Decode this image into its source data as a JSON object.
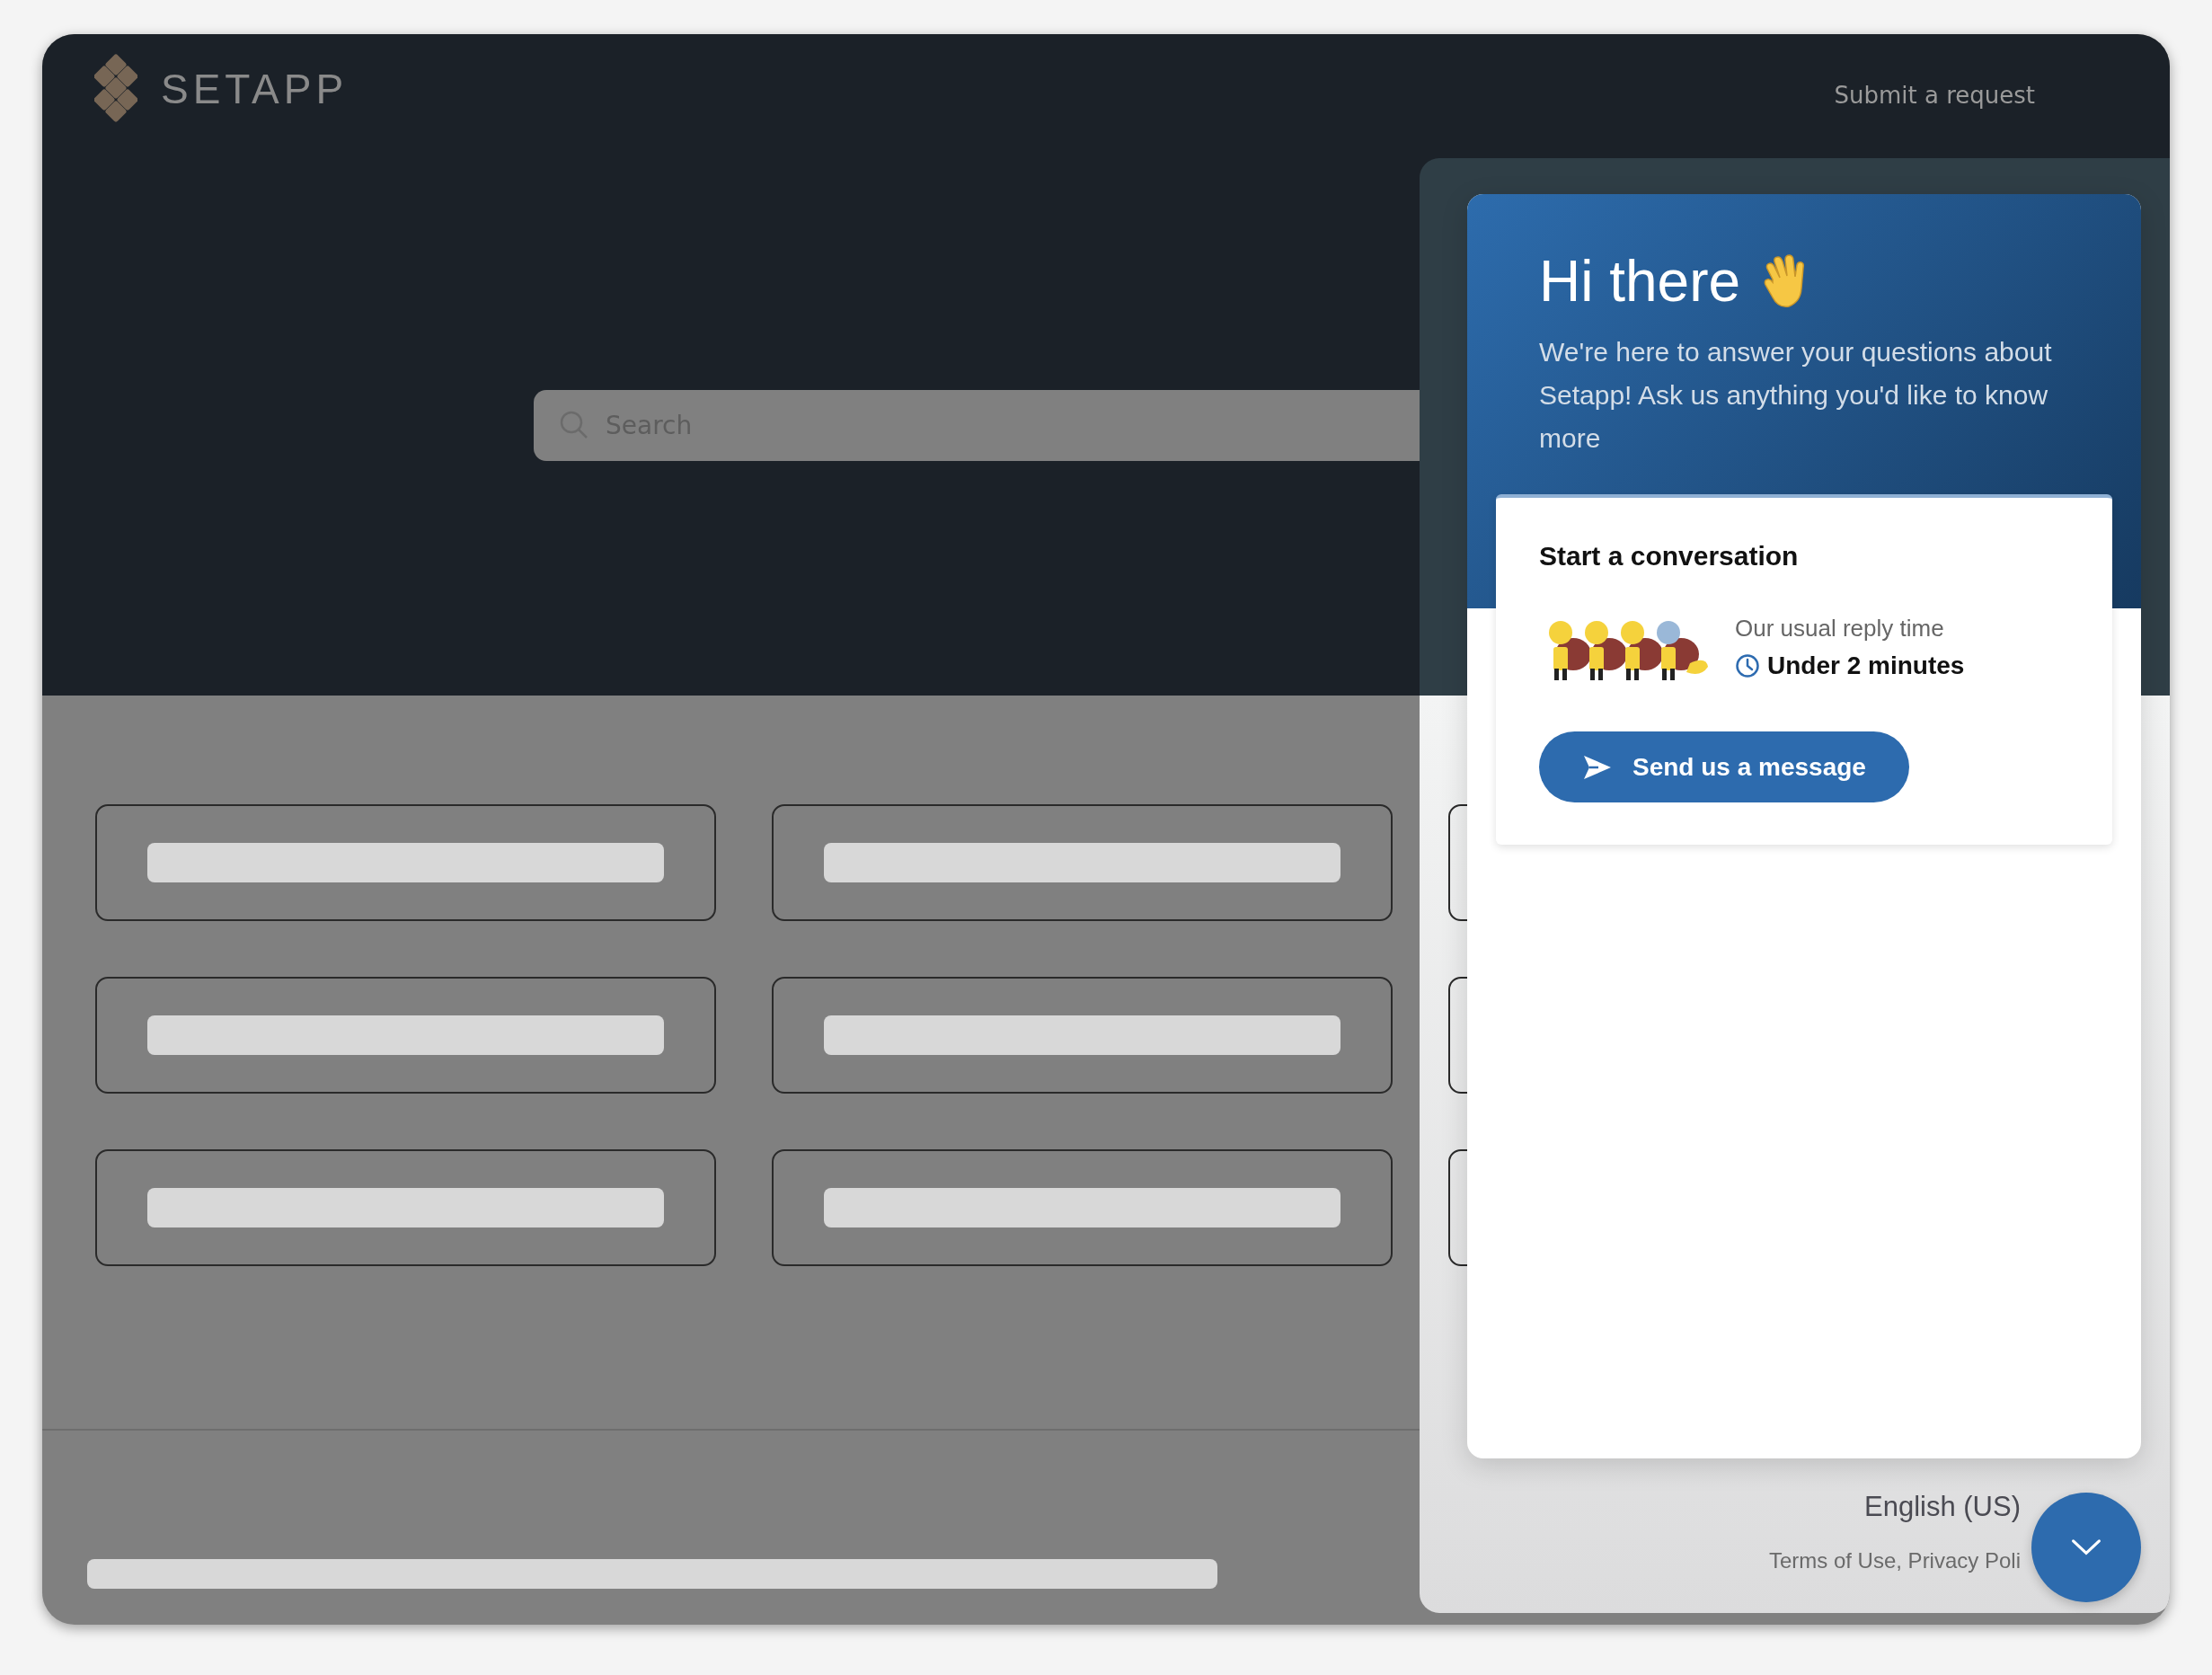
{
  "header": {
    "logo": "SETAPP",
    "link": "Submit a request"
  },
  "search": {
    "placeholder": "Search"
  },
  "cards": [
    {
      "kind": "skeleton"
    },
    {
      "kind": "skeleton"
    },
    {
      "kind": "edge"
    },
    {
      "kind": "skeleton"
    },
    {
      "kind": "skeleton"
    },
    {
      "kind": "edge"
    },
    {
      "kind": "skeleton"
    },
    {
      "kind": "skeleton"
    },
    {
      "kind": "edge"
    }
  ],
  "chat": {
    "greeting": "Hi there",
    "intro": "We're here to answer your questions about Setapp! Ask us anything you'd like to know more",
    "conversation": {
      "title": "Start a conversation",
      "reply_label": "Our usual reply time",
      "reply_time": "Under 2 minutes",
      "button": "Send us a message"
    }
  },
  "chat_footer": {
    "language": "English (US)",
    "links": "Terms of Use, Privacy Poli"
  }
}
